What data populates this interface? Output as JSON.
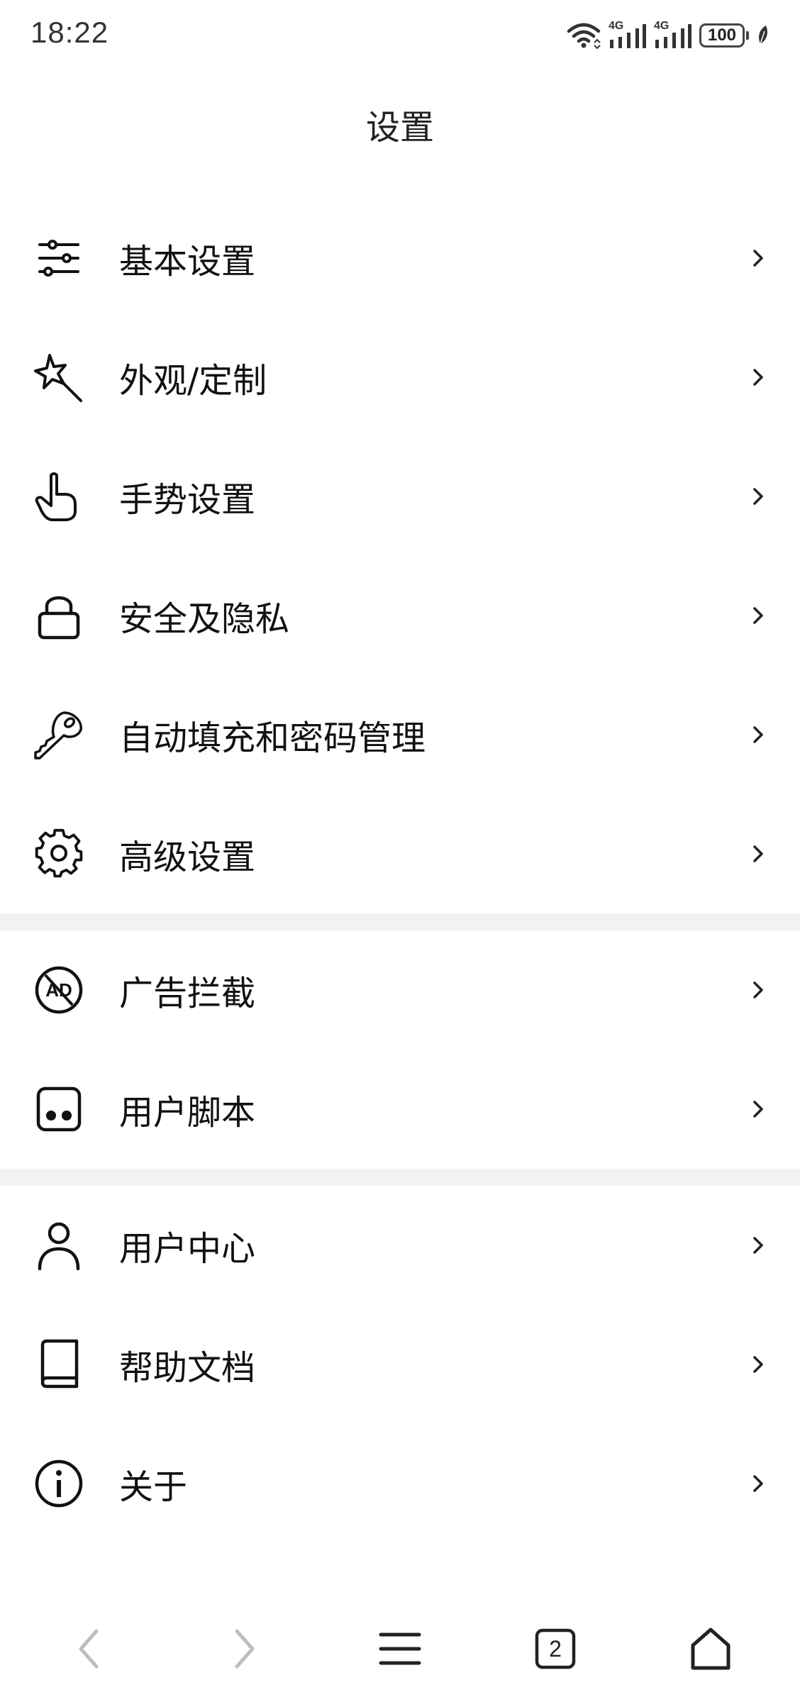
{
  "status_bar": {
    "time": "18:22",
    "signal_1": "4G",
    "signal_2": "4G",
    "battery": "100"
  },
  "header": {
    "title": "设置"
  },
  "groups": [
    {
      "items": [
        {
          "label": "基本设置",
          "icon": "sliders-icon"
        },
        {
          "label": "外观/定制",
          "icon": "magic-wand-icon"
        },
        {
          "label": "手势设置",
          "icon": "hand-pointer-icon"
        },
        {
          "label": "安全及隐私",
          "icon": "lock-icon"
        },
        {
          "label": "自动填充和密码管理",
          "icon": "key-icon"
        },
        {
          "label": "高级设置",
          "icon": "gear-icon"
        }
      ]
    },
    {
      "items": [
        {
          "label": "广告拦截",
          "icon": "ad-block-icon"
        },
        {
          "label": "用户脚本",
          "icon": "script-icon"
        }
      ]
    },
    {
      "items": [
        {
          "label": "用户中心",
          "icon": "user-icon"
        },
        {
          "label": "帮助文档",
          "icon": "book-icon"
        },
        {
          "label": "关于",
          "icon": "info-icon"
        }
      ]
    }
  ],
  "bottom_bar": {
    "back": "back-arrow-icon",
    "forward": "forward-arrow-icon",
    "menu": "menu-icon",
    "tabs_count": "2",
    "home": "home-icon"
  }
}
